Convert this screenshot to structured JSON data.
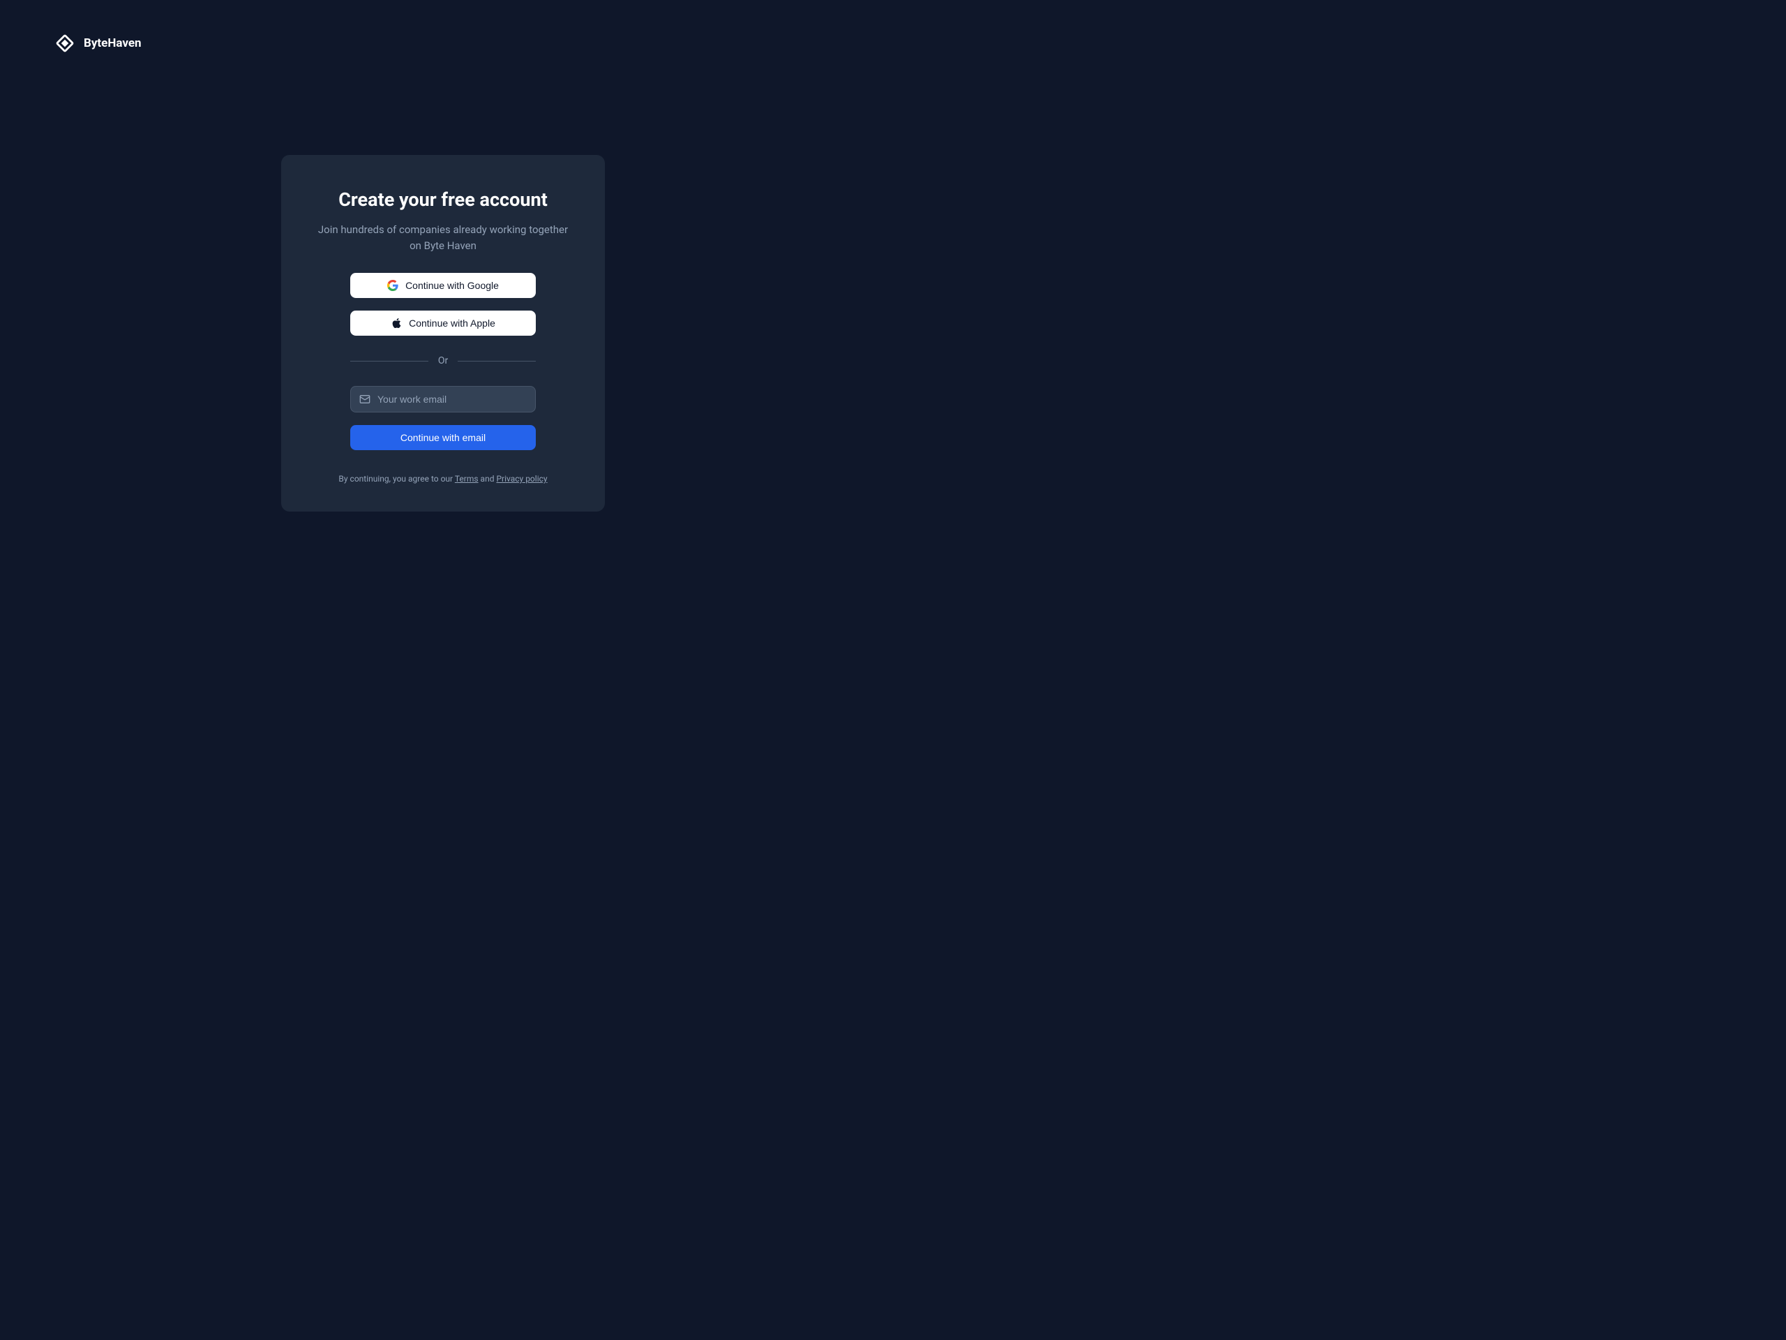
{
  "brand": {
    "name": "ByteHaven"
  },
  "card": {
    "title": "Create your free account",
    "subtitle": "Join hundreds of companies already working together on Byte Haven"
  },
  "oauth": {
    "google_label": "Continue with Google",
    "apple_label": "Continue with Apple"
  },
  "divider": {
    "label": "Or"
  },
  "form": {
    "email_placeholder": "Your work email",
    "submit_label": "Continue with email"
  },
  "legal": {
    "prefix": "By continuing, you agree to our ",
    "terms_label": "Terms",
    "mid": " and ",
    "privacy_label": "Privacy policy"
  }
}
